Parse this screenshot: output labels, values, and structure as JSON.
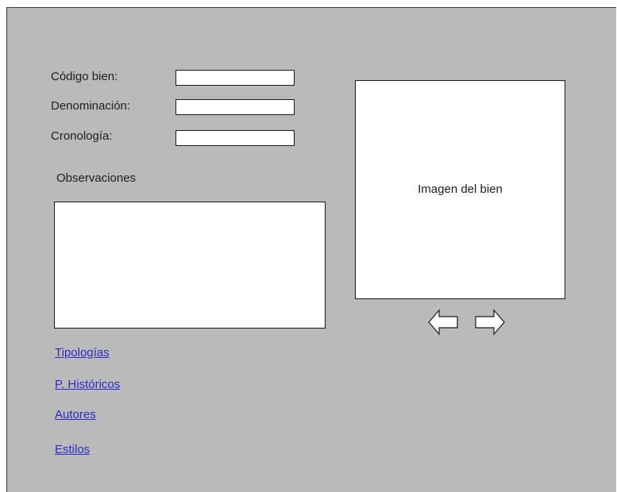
{
  "form": {
    "codigo_label": "Código bien:",
    "codigo_value": "",
    "denominacion_label": "Denominación:",
    "denominacion_value": "",
    "cronologia_label": "Cronología:",
    "cronologia_value": "",
    "observaciones_label": "Observaciones",
    "observaciones_value": ""
  },
  "image": {
    "caption": "Imagen del bien",
    "prev_icon": "arrow-left-icon",
    "next_icon": "arrow-right-icon"
  },
  "links": [
    {
      "label": "Tipologías"
    },
    {
      "label": "P. Históricos"
    },
    {
      "label": "Autores"
    },
    {
      "label": "Estilos"
    }
  ],
  "colors": {
    "background": "#bababa",
    "link": "#2a2ad0"
  }
}
